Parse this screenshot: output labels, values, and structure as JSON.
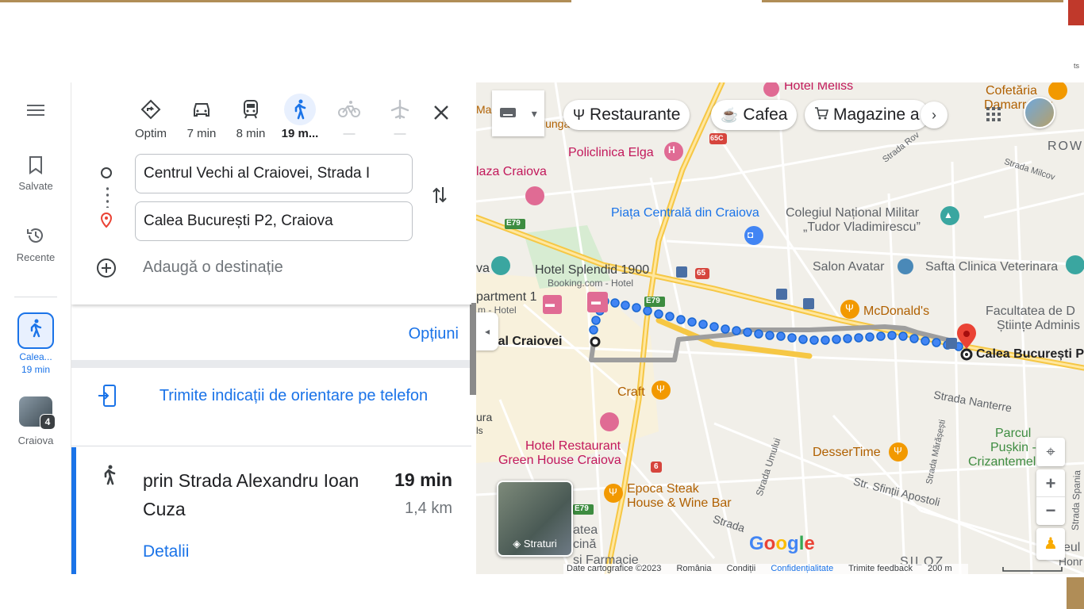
{
  "frame": {
    "corner_text": "ts"
  },
  "rail": {
    "menu_icon": "menu-icon",
    "saved_label": "Salvate",
    "recent_label": "Recente",
    "recent_route_label": "Calea...",
    "recent_route_time": "19 min",
    "recent_place_label": "Craiova",
    "recent_place_badge": "4"
  },
  "modes": [
    {
      "name": "best",
      "icon": "directions-icon",
      "label": "Optim"
    },
    {
      "name": "drive",
      "icon": "car-icon",
      "label": "7 min"
    },
    {
      "name": "transit",
      "icon": "train-icon",
      "label": "8 min"
    },
    {
      "name": "walk",
      "icon": "walk-icon",
      "label": "19 m..."
    },
    {
      "name": "bike",
      "icon": "bike-icon",
      "label": "—"
    },
    {
      "name": "flight",
      "icon": "plane-icon",
      "label": "—"
    }
  ],
  "directions": {
    "origin_value": "Centrul Vechi al Craiovei, Strada I",
    "destination_value": "Calea București P2, Craiova",
    "add_destination": "Adaugă o destinație",
    "options_label": "Opțiuni",
    "send_to_phone": "Trimite indicații de orientare pe telefon",
    "route": {
      "name": "prin Strada Alexandru Ioan Cuza",
      "time": "19 min",
      "distance": "1,4 km",
      "details": "Detalii"
    }
  },
  "map": {
    "chips": [
      {
        "icon": "restaurant-icon",
        "label": "Restaurante"
      },
      {
        "icon": "cafe-icon",
        "label": "Cafea"
      },
      {
        "icon": "cart-icon",
        "label": "Magazine a"
      }
    ],
    "labels": {
      "hotel_meliss": "Hotel Meliss",
      "cofetaria": "Cofetăria",
      "damarr": "Damarr Rov",
      "lunga": "lunga",
      "ma": "Ma",
      "policlinica": "Policlinica Elga",
      "plaza": "laza Craiova",
      "piata": "Piața Centrală din Craiova",
      "colegiul1": "Colegiul Național Militar",
      "colegiul2": "„Tudor Vladimirescu”",
      "row": "ROW",
      "hotel_splendid": "Hotel Splendid 1900",
      "booking": "Booking.com - Hotel",
      "salon": "Salon Avatar",
      "safta": "Safta Clinica Veterinara",
      "apartment": "partment 1",
      "apartment2": "m - Hotel",
      "mcdonalds": "McDonald's",
      "facultatea1": "Facultatea de D",
      "facultatea2": "Științe Adminis",
      "origin": "chi al Craiovei",
      "destination": "Calea București P",
      "va": "va",
      "craft": "Craft",
      "strada_nanterre": "Strada Nanterre",
      "ura": "ura",
      "ls": "ls",
      "hotel_rest1": "Hotel Restaurant",
      "hotel_rest2": "Green House Craiova",
      "parcul1": "Parcul",
      "parcul2": "Pușkin -",
      "parcul3": "Crizantemelor",
      "dessertime": "DesserTime",
      "epoca1": "Epoca Steak",
      "epoca2": "House & Wine Bar",
      "str_sfintii": "Str. Sfinții Apostoli",
      "strada_umului": "Strada Umului",
      "strada_marasti": "Strada Mărășești",
      "strada_rov": "Strada Rov",
      "strada_milcov": "Strada Milcov",
      "strada_spania": "Strada Spania",
      "strada_bottom": "Strada",
      "atea": "atea",
      "cina": "cină",
      "si_farmacie": "și Farmacie",
      "siloz": "SILOZ",
      "eul": "eul",
      "hon": "Honr",
      "e79a": "E79",
      "e79b": "E79",
      "e79c": "E79",
      "r65": "65",
      "r65c": "65C",
      "r6": "6"
    },
    "layers_label": "Straturi",
    "google_logo": "Google",
    "attribution": {
      "data": "Date cartografice ©2023",
      "country": "România",
      "terms": "Condiții",
      "privacy": "Confidențialitate",
      "feedback": "Trimite feedback",
      "scale": "200 m"
    },
    "route_color": "#4285f4",
    "alt_route_color": "#9e9e9e"
  },
  "colors": {
    "accent": "#1a73e8",
    "frame_gold": "#b08d57",
    "pin_red": "#ea4335",
    "poi_pink": "#e06b94",
    "poi_orange": "#f29900",
    "poi_blue": "#4285f4",
    "poi_teal": "#3aa6a0"
  }
}
